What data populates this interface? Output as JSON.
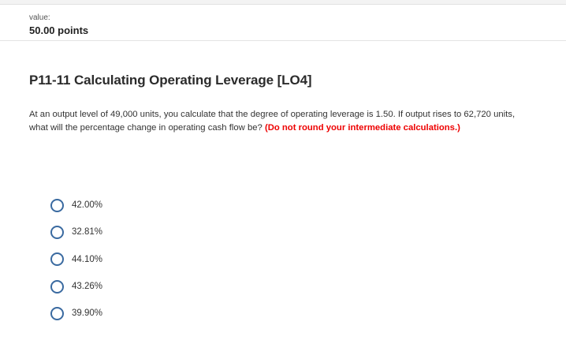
{
  "header": {
    "value_label": "value:",
    "points": "50.00 points"
  },
  "problem": {
    "title": "P11-11 Calculating Operating Leverage [LO4]",
    "text": "At an output level of 49,000 units, you calculate that the degree of operating leverage is 1.50. If output rises to 62,720 units, what will the percentage change in operating cash flow be?",
    "note": "(Do not round your intermediate calculations.)"
  },
  "options": [
    {
      "label": "42.00%"
    },
    {
      "label": "32.81%"
    },
    {
      "label": "44.10%"
    },
    {
      "label": "43.26%"
    },
    {
      "label": "39.90%"
    }
  ],
  "colors": {
    "radio": "#3a6aa0",
    "note": "#ee0000"
  }
}
